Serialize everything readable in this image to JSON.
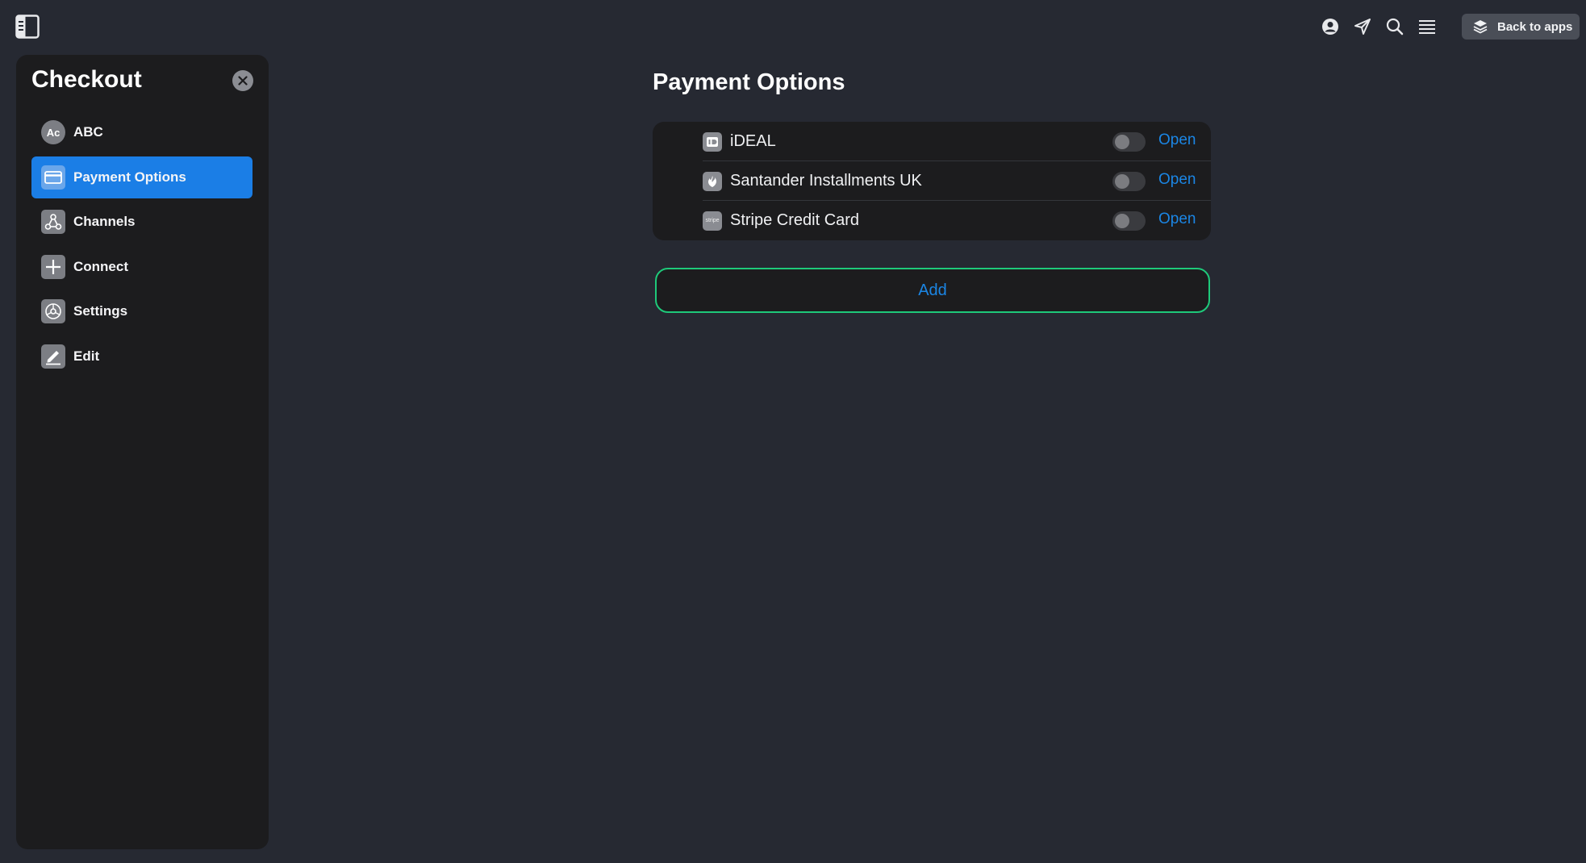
{
  "topbar": {
    "back_label": "Back to apps",
    "icons": [
      "sidebar-toggle-icon",
      "user-icon",
      "send-icon",
      "search-icon",
      "menu-icon",
      "layers-icon"
    ]
  },
  "sidebar": {
    "title": "Checkout",
    "items": [
      {
        "label": "ABC",
        "icon": "avatar-ac",
        "avatar_text": "Ac",
        "active": false
      },
      {
        "label": "Payment Options",
        "icon": "credit-card-icon",
        "active": true
      },
      {
        "label": "Channels",
        "icon": "channels-icon",
        "active": false
      },
      {
        "label": "Connect",
        "icon": "plus-icon",
        "active": false
      },
      {
        "label": "Settings",
        "icon": "settings-icon",
        "active": false
      },
      {
        "label": "Edit",
        "icon": "edit-icon",
        "active": false
      }
    ]
  },
  "main": {
    "title": "Payment Options",
    "options": [
      {
        "label": "iDEAL",
        "icon": "ideal-icon",
        "enabled": false,
        "link": "Open"
      },
      {
        "label": "Santander Installments UK",
        "icon": "santander-icon",
        "enabled": false,
        "link": "Open"
      },
      {
        "label": "Stripe Credit Card",
        "icon": "stripe-icon",
        "icon_text": "stripe",
        "enabled": false,
        "link": "Open"
      }
    ],
    "add_label": "Add"
  },
  "colors": {
    "background": "#262932",
    "panel": "#1c1c1e",
    "accent": "#1b7ee6",
    "link": "#1b86e5",
    "add_border": "#1ec97a"
  }
}
